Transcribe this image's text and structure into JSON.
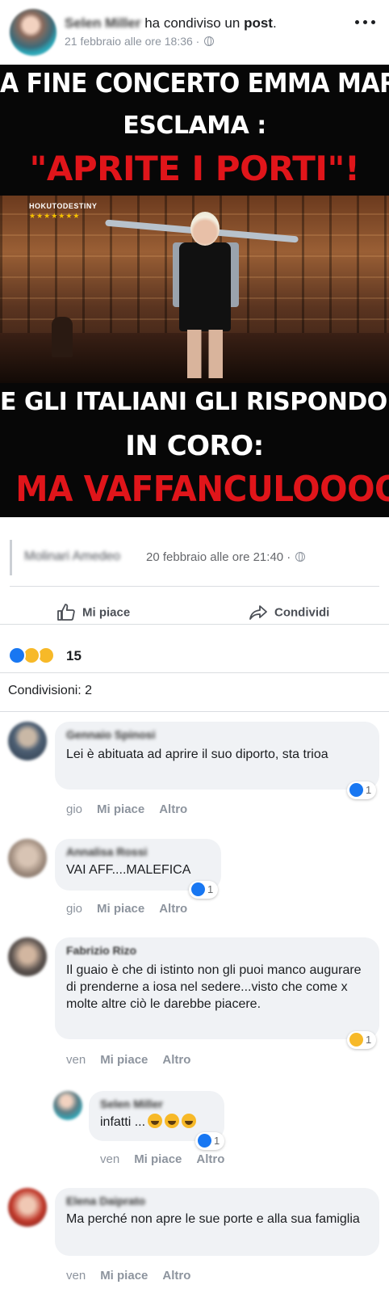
{
  "header": {
    "author": "Selen Miller",
    "action_text": " ha condiviso un ",
    "post_word": "post",
    "period": ".",
    "timestamp": "21 febbraio alle ore 18:36 · "
  },
  "meme": {
    "top_line1": "A FINE CONCERTO EMMA MARRONE",
    "top_line2": "ESCLAMA :",
    "top_line3": "\"APRITE I PORTI\"!",
    "bottom_line1": "E GLI ITALIANI GLI RISPONDONO",
    "bottom_line2": "IN CORO:",
    "bottom_line3": "MA VAFFANCULOOOOO!!!",
    "watermark": "HOKUTODESTINY",
    "watermark_stars": "★★★★★★★"
  },
  "original_post": {
    "author": "Molinari Amedeo",
    "timestamp": "20 febbraio alle ore 21:40 · "
  },
  "actions": {
    "like_label": "Mi piace",
    "share_label": "Condividi"
  },
  "reactions": {
    "count": "15",
    "types": [
      "like-icon",
      "haha-icon",
      "wow-icon"
    ],
    "colors": {
      "like": "#1877f2",
      "haha": "#f7b928"
    }
  },
  "shares_label": "Condivisioni: 2",
  "comments": [
    {
      "name": "Gennaio Spinosi",
      "text": "Lei è abituata ad aprire il suo diporto, sta trioa",
      "time": "gio",
      "like": "Mi piace",
      "more": "Altro",
      "reaction_count": "1"
    },
    {
      "name": "Annalisa Rossi",
      "text": "VAI AFF....MALEFICA",
      "time": "gio",
      "like": "Mi piace",
      "more": "Altro",
      "reaction_count": "1"
    },
    {
      "name": "Fabrizio Rizo",
      "text": "Il guaio è che di istinto non gli puoi manco augurare di prenderne a iosa nel sedere...visto che come x molte altre ciò le darebbe piacere.",
      "time": "ven",
      "like": "Mi piace",
      "more": "Altro",
      "reaction_count": "1"
    },
    {
      "name": "Selen Miller",
      "text": "infatti ...",
      "time": "ven",
      "like": "Mi piace",
      "more": "Altro",
      "reaction_count": "1"
    },
    {
      "name": "Elena Daiprato",
      "text": "Ma perché non apre le sue porte e alla sua famiglia",
      "time": "ven",
      "like": "Mi piace",
      "more": "Altro"
    }
  ]
}
